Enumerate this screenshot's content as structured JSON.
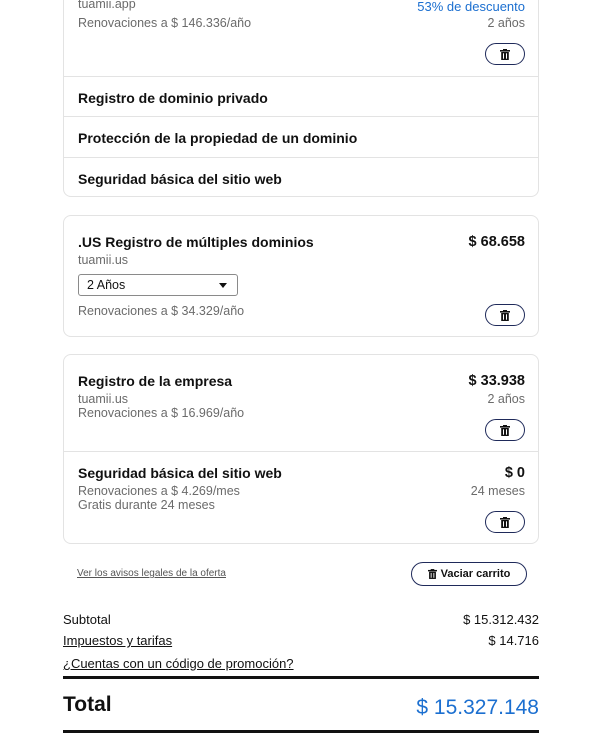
{
  "card1": {
    "domain": "tuamii.app",
    "discount": "53% de descuento",
    "renewal": "Renovaciones a $ 146.336/año",
    "term": "2 años",
    "addons": [
      "Registro de dominio privado",
      "Protección de la propiedad de un dominio",
      "Seguridad básica del sitio web"
    ]
  },
  "card2": {
    "title": ".US Registro de múltiples dominios",
    "price": "$ 68.658",
    "domain": "tuamii.us",
    "select_value": "2 Años",
    "renewal": "Renovaciones a $ 34.329/año"
  },
  "card3": {
    "item1": {
      "title": "Registro de la empresa",
      "price": "$ 33.938",
      "domain": "tuamii.us",
      "term": "2 años",
      "renewal": "Renovaciones a $ 16.969/año"
    },
    "item2": {
      "title": "Seguridad básica del sitio web",
      "price": "$ 0",
      "renewal": "Renovaciones a $ 4.269/mes",
      "term": "24 meses",
      "free_note": "Gratis durante 24 meses"
    }
  },
  "legal_link": "Ver los avisos legales de la oferta",
  "empty_cart_label": "Vaciar carrito",
  "summary": {
    "subtotal_label": "Subtotal",
    "subtotal_value": "$ 15.312.432",
    "taxes_label": "Impuestos y tarifas",
    "taxes_value": "$ 14.716",
    "promo_label": "¿Cuentas con un código de promoción?",
    "total_label": "Total",
    "total_value": "$ 15.327.148"
  },
  "colors": {
    "accent": "#1b6fd0",
    "border": "#e3e3e3",
    "button_border": "#1f2a5a"
  },
  "icons": {
    "trash": "trash-icon",
    "caret": "chevron-down-icon"
  }
}
